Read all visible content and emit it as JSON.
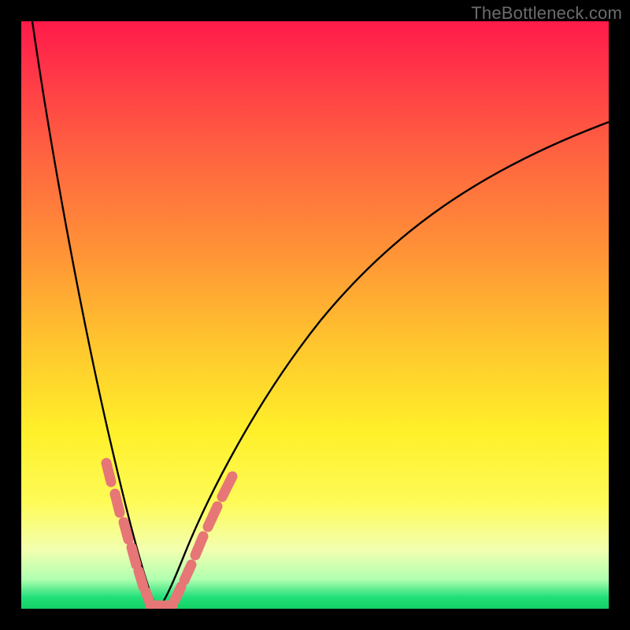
{
  "watermark": "TheBottleneck.com",
  "colors": {
    "gradient_top": "#ff1a4a",
    "gradient_bottom": "#12d164",
    "curve": "#000000",
    "dash": "#e77676",
    "frame_bg": "#000000"
  },
  "chart_data": {
    "type": "line",
    "title": "",
    "xlabel": "",
    "ylabel": "",
    "xlim": [
      0,
      100
    ],
    "ylim": [
      0,
      100
    ],
    "note": "No axis ticks or numeric labels are rendered; values are estimated from curve geometry in percent of plot area.",
    "series": [
      {
        "name": "left-branch",
        "x": [
          2,
          5,
          8,
          11,
          14,
          17,
          19,
          20,
          21,
          22
        ],
        "y": [
          100,
          80,
          60,
          42,
          28,
          16,
          8,
          4,
          1,
          0
        ]
      },
      {
        "name": "right-branch",
        "x": [
          22,
          24,
          27,
          32,
          40,
          50,
          60,
          72,
          85,
          100
        ],
        "y": [
          0,
          3,
          10,
          22,
          38,
          52,
          62,
          71,
          78,
          83
        ]
      }
    ],
    "dash_segments_left": [
      {
        "x": 14.9,
        "y": 24.0
      },
      {
        "x": 16.4,
        "y": 19.0
      },
      {
        "x": 17.6,
        "y": 14.5
      },
      {
        "x": 18.7,
        "y": 10.0
      },
      {
        "x": 19.7,
        "y": 6.0
      },
      {
        "x": 20.8,
        "y": 2.4
      }
    ],
    "dash_segments_right": [
      {
        "x": 24.8,
        "y": 2.4
      },
      {
        "x": 26.3,
        "y": 6.3
      },
      {
        "x": 28.2,
        "y": 11.5
      },
      {
        "x": 30.5,
        "y": 17.5
      },
      {
        "x": 33.1,
        "y": 23.5
      }
    ],
    "dash_segments_bottom": [
      {
        "x": 22.0,
        "y": 0.6
      },
      {
        "x": 23.4,
        "y": 0.6
      }
    ]
  }
}
